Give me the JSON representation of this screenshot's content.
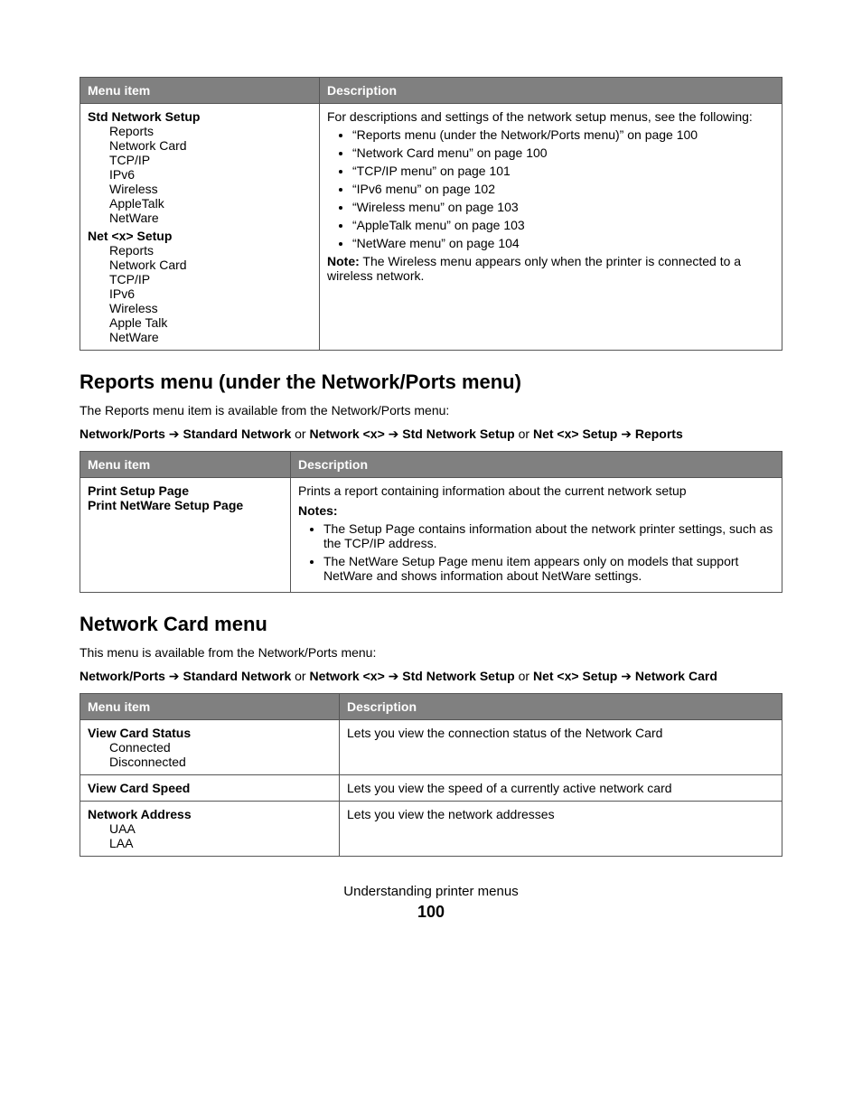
{
  "table1": {
    "head": {
      "c1": "Menu item",
      "c2": "Description"
    },
    "menu": {
      "group1": "Std Network Setup",
      "items1": [
        "Reports",
        "Network Card",
        "TCP/IP",
        "IPv6",
        "Wireless",
        "AppleTalk",
        "NetWare"
      ],
      "group2": "Net <x> Setup",
      "items2": [
        "Reports",
        "Network Card",
        "TCP/IP",
        "IPv6",
        "Wireless",
        "Apple Talk",
        "NetWare"
      ]
    },
    "desc": {
      "intro": "For descriptions and settings of the network setup menus, see the following:",
      "bullets": [
        "“Reports menu (under the Network/Ports menu)” on page 100",
        "“Network Card menu” on page 100",
        "“TCP/IP menu” on page 101",
        "“IPv6 menu” on page 102",
        "“Wireless menu” on page 103",
        "“AppleTalk menu” on page 103",
        "“NetWare menu” on page 104"
      ],
      "notelabel": "Note:",
      "notetext": " The Wireless menu appears only when the printer is connected to a wireless network."
    }
  },
  "section1": {
    "heading": "Reports menu (under the Network/Ports menu)",
    "intro": "The Reports menu item is available from the Network/Ports menu:",
    "path": {
      "p1": "Network/Ports",
      "arrow": " ➔ ",
      "p2": "Standard Network",
      "or": " or ",
      "p3": "Network <x>",
      "p4": "Std Network Setup",
      "p5": "Net <x> Setup",
      "p6": "Reports"
    }
  },
  "table2": {
    "head": {
      "c1": "Menu item",
      "c2": "Description"
    },
    "menu": {
      "line1": "Print Setup Page",
      "line2": "Print NetWare Setup Page"
    },
    "desc": {
      "line1": "Prints a report containing information about the current network setup",
      "noteslabel": "Notes:",
      "bullets": [
        "The Setup Page contains information about the network printer settings, such as the TCP/IP address.",
        "The NetWare Setup Page menu item appears only on models that support NetWare and shows information about NetWare settings."
      ]
    }
  },
  "section2": {
    "heading": "Network Card menu",
    "intro": "This menu is available from the Network/Ports menu:",
    "path": {
      "p1": "Network/Ports",
      "arrow": " ➔ ",
      "p2": "Standard Network",
      "or": " or ",
      "p3": "Network <x>",
      "p4": "Std Network Setup",
      "p5": "Net <x> Setup",
      "p6": "Network Card"
    }
  },
  "table3": {
    "head": {
      "c1": "Menu item",
      "c2": "Description"
    },
    "row1": {
      "title": "View Card Status",
      "sub": [
        "Connected",
        "Disconnected"
      ],
      "desc": "Lets you view the connection status of the Network Card"
    },
    "row2": {
      "title": "View Card Speed",
      "desc": "Lets you view the speed of a currently active network card"
    },
    "row3": {
      "title": "Network Address",
      "sub": [
        "UAA",
        "LAA"
      ],
      "desc": "Lets you view the network addresses"
    }
  },
  "footer": {
    "title": "Understanding printer menus",
    "page": "100"
  }
}
